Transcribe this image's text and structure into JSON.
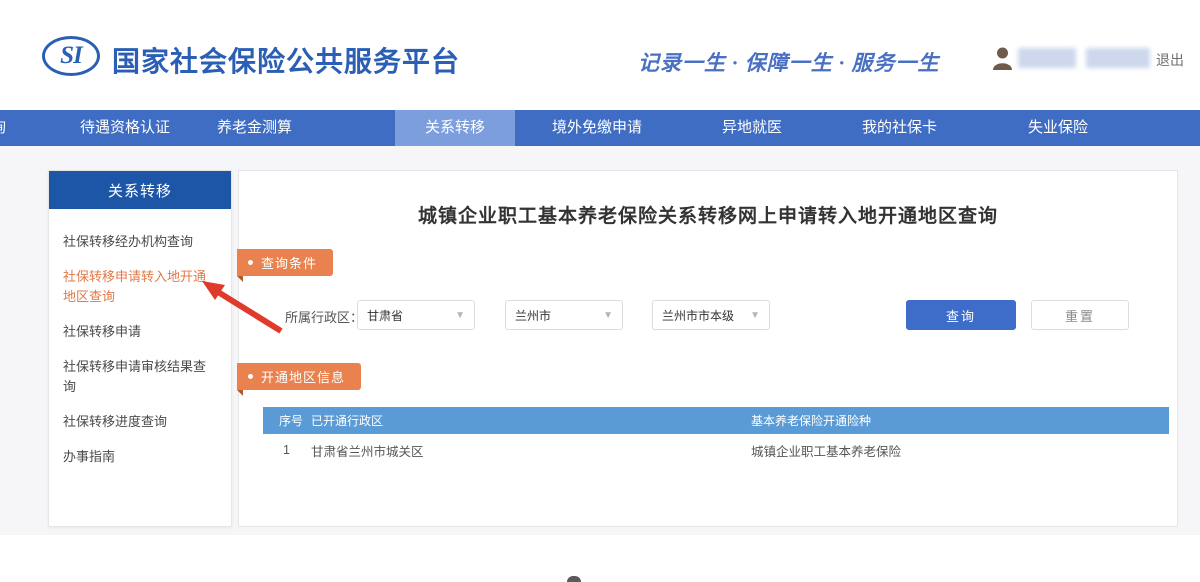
{
  "header": {
    "logo_text": "SI",
    "site_title": "国家社会保险公共服务平台",
    "slogan": "记录一生 · 保障一生 · 服务一生",
    "logout_label": "退出"
  },
  "nav": {
    "items": [
      {
        "label": "询"
      },
      {
        "label": "待遇资格认证"
      },
      {
        "label": "养老金测算"
      },
      {
        "label": "关系转移"
      },
      {
        "label": "境外免缴申请"
      },
      {
        "label": "异地就医"
      },
      {
        "label": "我的社保卡"
      },
      {
        "label": "失业保险"
      }
    ],
    "active_item": "关系转移"
  },
  "sidebar": {
    "title": "关系转移",
    "items": [
      {
        "label": "社保转移经办机构查询"
      },
      {
        "label": "社保转移申请转入地开通地区查询"
      },
      {
        "label": "社保转移申请"
      },
      {
        "label": "社保转移申请审核结果查询"
      },
      {
        "label": "社保转移进度查询"
      },
      {
        "label": "办事指南"
      }
    ],
    "active_item": "社保转移申请转入地开通地区查询"
  },
  "main": {
    "page_title": "城镇企业职工基本养老保险关系转移网上申请转入地开通地区查询",
    "query_section_label": "查询条件",
    "form": {
      "region_label": "所属行政区：",
      "province_value": "甘肃省",
      "city_value": "兰州市",
      "district_value": "兰州市市本级",
      "query_button": "查询",
      "reset_button": "重置"
    },
    "result_section_label": "开通地区信息",
    "table": {
      "columns": [
        "序号",
        "已开通行政区",
        "基本养老保险开通险种"
      ],
      "rows": [
        {
          "no": "1",
          "region": "甘肃省兰州市城关区",
          "insurance": "城镇企业职工基本养老保险"
        }
      ]
    }
  },
  "colors": {
    "nav_blue": "#3f6dc3",
    "nav_active_blue": "#7d9edd",
    "sidebar_header_blue": "#1e56a7",
    "brand_blue": "#2b5fb5",
    "badge_orange": "#e9824e",
    "table_header_blue": "#5b9bd5",
    "query_button_blue": "#3d6cc9",
    "active_link_orange": "#e2794a",
    "annotation_red": "#e03a2b"
  }
}
